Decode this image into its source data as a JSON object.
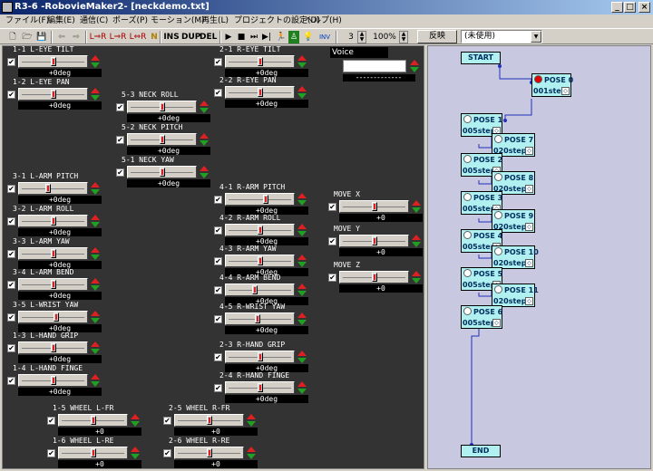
{
  "window": {
    "title": "R3-6 -RobovieMaker2-  [neckdemo.txt]",
    "min_label": "_",
    "max_label": "□",
    "close_label": "×"
  },
  "menu": [
    "ファイル(F)",
    "編集(E)",
    "通信(C)",
    "ポーズ(P)",
    "モーション(M)",
    "再生(L)",
    "プロジェクトの設定(D)",
    "ヘルプ(H)"
  ],
  "toolbar": {
    "ins": "INS",
    "dup": "DUP",
    "del": "DEL",
    "count": "3",
    "zoom": "100%",
    "hanten": "反映",
    "combo": "(未使用)",
    "l_arm": "L⇒R",
    "r_arm": "L⇒R",
    "l_r": "L⇔R",
    "norm": "N",
    "inv": "INV"
  },
  "voice": {
    "label": "Voice",
    "value": "",
    "dashes": "-------------"
  },
  "controls": [
    {
      "id": "1-1",
      "label": "1-1 L-EYE TILT",
      "value": "+0deg",
      "thumb": 0.5
    },
    {
      "id": "1-2",
      "label": "1-2 L-EYE PAN",
      "value": "+0deg",
      "thumb": 0.5
    },
    {
      "id": "2-1",
      "label": "2-1 R-EYE TILT",
      "value": "+0deg",
      "thumb": 0.5
    },
    {
      "id": "2-2",
      "label": "2-2 R-EYE PAN",
      "value": "+0deg",
      "thumb": 0.5
    },
    {
      "id": "5-3",
      "label": "5-3 NECK ROLL",
      "value": "+0deg",
      "thumb": 0.5
    },
    {
      "id": "5-2",
      "label": "5-2 NECK PITCH",
      "value": "+0deg",
      "thumb": 0.5
    },
    {
      "id": "5-1",
      "label": "5-1 NECK YAW",
      "value": "+0deg",
      "thumb": 0.5
    },
    {
      "id": "3-1",
      "label": "3-1 L-ARM PITCH",
      "value": "+0deg",
      "thumb": 0.4
    },
    {
      "id": "3-2",
      "label": "3-2 L-ARM ROLL",
      "value": "+0deg",
      "thumb": 0.5
    },
    {
      "id": "3-3",
      "label": "3-3 L-ARM YAW",
      "value": "+0deg",
      "thumb": 0.5
    },
    {
      "id": "3-4",
      "label": "3-4 L-ARM BEND",
      "value": "+0deg",
      "thumb": 0.5
    },
    {
      "id": "3-5",
      "label": "3-5 L-WRIST YAW",
      "value": "+0deg",
      "thumb": 0.55
    },
    {
      "id": "1-3",
      "label": "1-3 L-HAND GRIP",
      "value": "+0deg",
      "thumb": 0.5
    },
    {
      "id": "1-4",
      "label": "1-4 L-HAND FINGE",
      "value": "+0deg",
      "thumb": 0.5
    },
    {
      "id": "4-1",
      "label": "4-1 R-ARM PITCH",
      "value": "+0deg",
      "thumb": 0.6
    },
    {
      "id": "4-2",
      "label": "4-2 R-ARM ROLL",
      "value": "+0deg",
      "thumb": 0.5
    },
    {
      "id": "4-3",
      "label": "4-3 R-ARM YAW",
      "value": "+0deg",
      "thumb": 0.5
    },
    {
      "id": "4-4",
      "label": "4-4 R-ARM BEND",
      "value": "+0deg",
      "thumb": 0.4
    },
    {
      "id": "4-5",
      "label": "4-5 R-WRIST YAW",
      "value": "+0deg",
      "thumb": 0.45
    },
    {
      "id": "2-3",
      "label": "2-3 R-HAND GRIP",
      "value": "+0deg",
      "thumb": 0.5
    },
    {
      "id": "2-4",
      "label": "2-4 R-HAND FINGE",
      "value": "+0deg",
      "thumb": 0.5
    },
    {
      "id": "1-5",
      "label": "1-5 WHEEL L-FR",
      "value": "+0",
      "thumb": 0.5
    },
    {
      "id": "1-6",
      "label": "1-6 WHEEL L-RE",
      "value": "+0",
      "thumb": 0.5
    },
    {
      "id": "2-5",
      "label": "2-5 WHEEL R-FR",
      "value": "+0",
      "thumb": 0.5
    },
    {
      "id": "2-6",
      "label": "2-6 WHEEL R-RE",
      "value": "+0",
      "thumb": 0.5
    },
    {
      "id": "mx",
      "label": "MOVE X",
      "value": "+0",
      "thumb": 0.5
    },
    {
      "id": "my",
      "label": "MOVE Y",
      "value": "+0",
      "thumb": 0.5
    },
    {
      "id": "mz",
      "label": "MOVE Z",
      "value": "+0",
      "thumb": 0.5
    }
  ],
  "flow": {
    "start": "START",
    "end": "END",
    "nodes": [
      {
        "id": "p0",
        "title": "POSE 0",
        "step": "001step",
        "active": true
      },
      {
        "id": "p1",
        "title": "POSE 1",
        "step": "005step",
        "active": false
      },
      {
        "id": "p7",
        "title": "POSE 7",
        "step": "020step",
        "active": false
      },
      {
        "id": "p2",
        "title": "POSE 2",
        "step": "005step",
        "active": false
      },
      {
        "id": "p8",
        "title": "POSE 8",
        "step": "020step",
        "active": false
      },
      {
        "id": "p3",
        "title": "POSE 3",
        "step": "005step",
        "active": false
      },
      {
        "id": "p9",
        "title": "POSE 9",
        "step": "020step",
        "active": false
      },
      {
        "id": "p4",
        "title": "POSE 4",
        "step": "005step",
        "active": false
      },
      {
        "id": "p10",
        "title": "POSE 10",
        "step": "020step",
        "active": false
      },
      {
        "id": "p5",
        "title": "POSE 5",
        "step": "005step",
        "active": false
      },
      {
        "id": "p11",
        "title": "POSE 11",
        "step": "020step",
        "active": false
      },
      {
        "id": "p6",
        "title": "POSE 6",
        "step": "005step",
        "active": false
      }
    ]
  }
}
